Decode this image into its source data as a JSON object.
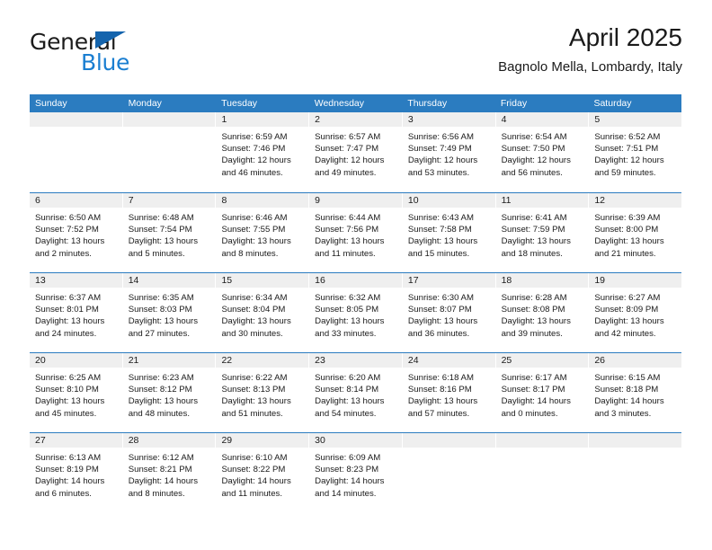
{
  "brand": {
    "name_dark": "General",
    "name_light": "Blue",
    "accent_blue": "#1a7ed1",
    "triangle_blue": "#1464ad"
  },
  "header": {
    "title": "April 2025",
    "subtitle": "Bagnolo Mella, Lombardy, Italy"
  },
  "theme": {
    "header_bg": "#2b7cc0",
    "day_band_bg": "#efefef",
    "separator": "#2b7cc0"
  },
  "weekdays": [
    "Sunday",
    "Monday",
    "Tuesday",
    "Wednesday",
    "Thursday",
    "Friday",
    "Saturday"
  ],
  "weeks": [
    {
      "days": [
        {
          "number": "",
          "sunrise": "",
          "sunset": "",
          "daylight": ""
        },
        {
          "number": "",
          "sunrise": "",
          "sunset": "",
          "daylight": ""
        },
        {
          "number": "1",
          "sunrise": "Sunrise: 6:59 AM",
          "sunset": "Sunset: 7:46 PM",
          "daylight": "Daylight: 12 hours and 46 minutes."
        },
        {
          "number": "2",
          "sunrise": "Sunrise: 6:57 AM",
          "sunset": "Sunset: 7:47 PM",
          "daylight": "Daylight: 12 hours and 49 minutes."
        },
        {
          "number": "3",
          "sunrise": "Sunrise: 6:56 AM",
          "sunset": "Sunset: 7:49 PM",
          "daylight": "Daylight: 12 hours and 53 minutes."
        },
        {
          "number": "4",
          "sunrise": "Sunrise: 6:54 AM",
          "sunset": "Sunset: 7:50 PM",
          "daylight": "Daylight: 12 hours and 56 minutes."
        },
        {
          "number": "5",
          "sunrise": "Sunrise: 6:52 AM",
          "sunset": "Sunset: 7:51 PM",
          "daylight": "Daylight: 12 hours and 59 minutes."
        }
      ]
    },
    {
      "days": [
        {
          "number": "6",
          "sunrise": "Sunrise: 6:50 AM",
          "sunset": "Sunset: 7:52 PM",
          "daylight": "Daylight: 13 hours and 2 minutes."
        },
        {
          "number": "7",
          "sunrise": "Sunrise: 6:48 AM",
          "sunset": "Sunset: 7:54 PM",
          "daylight": "Daylight: 13 hours and 5 minutes."
        },
        {
          "number": "8",
          "sunrise": "Sunrise: 6:46 AM",
          "sunset": "Sunset: 7:55 PM",
          "daylight": "Daylight: 13 hours and 8 minutes."
        },
        {
          "number": "9",
          "sunrise": "Sunrise: 6:44 AM",
          "sunset": "Sunset: 7:56 PM",
          "daylight": "Daylight: 13 hours and 11 minutes."
        },
        {
          "number": "10",
          "sunrise": "Sunrise: 6:43 AM",
          "sunset": "Sunset: 7:58 PM",
          "daylight": "Daylight: 13 hours and 15 minutes."
        },
        {
          "number": "11",
          "sunrise": "Sunrise: 6:41 AM",
          "sunset": "Sunset: 7:59 PM",
          "daylight": "Daylight: 13 hours and 18 minutes."
        },
        {
          "number": "12",
          "sunrise": "Sunrise: 6:39 AM",
          "sunset": "Sunset: 8:00 PM",
          "daylight": "Daylight: 13 hours and 21 minutes."
        }
      ]
    },
    {
      "days": [
        {
          "number": "13",
          "sunrise": "Sunrise: 6:37 AM",
          "sunset": "Sunset: 8:01 PM",
          "daylight": "Daylight: 13 hours and 24 minutes."
        },
        {
          "number": "14",
          "sunrise": "Sunrise: 6:35 AM",
          "sunset": "Sunset: 8:03 PM",
          "daylight": "Daylight: 13 hours and 27 minutes."
        },
        {
          "number": "15",
          "sunrise": "Sunrise: 6:34 AM",
          "sunset": "Sunset: 8:04 PM",
          "daylight": "Daylight: 13 hours and 30 minutes."
        },
        {
          "number": "16",
          "sunrise": "Sunrise: 6:32 AM",
          "sunset": "Sunset: 8:05 PM",
          "daylight": "Daylight: 13 hours and 33 minutes."
        },
        {
          "number": "17",
          "sunrise": "Sunrise: 6:30 AM",
          "sunset": "Sunset: 8:07 PM",
          "daylight": "Daylight: 13 hours and 36 minutes."
        },
        {
          "number": "18",
          "sunrise": "Sunrise: 6:28 AM",
          "sunset": "Sunset: 8:08 PM",
          "daylight": "Daylight: 13 hours and 39 minutes."
        },
        {
          "number": "19",
          "sunrise": "Sunrise: 6:27 AM",
          "sunset": "Sunset: 8:09 PM",
          "daylight": "Daylight: 13 hours and 42 minutes."
        }
      ]
    },
    {
      "days": [
        {
          "number": "20",
          "sunrise": "Sunrise: 6:25 AM",
          "sunset": "Sunset: 8:10 PM",
          "daylight": "Daylight: 13 hours and 45 minutes."
        },
        {
          "number": "21",
          "sunrise": "Sunrise: 6:23 AM",
          "sunset": "Sunset: 8:12 PM",
          "daylight": "Daylight: 13 hours and 48 minutes."
        },
        {
          "number": "22",
          "sunrise": "Sunrise: 6:22 AM",
          "sunset": "Sunset: 8:13 PM",
          "daylight": "Daylight: 13 hours and 51 minutes."
        },
        {
          "number": "23",
          "sunrise": "Sunrise: 6:20 AM",
          "sunset": "Sunset: 8:14 PM",
          "daylight": "Daylight: 13 hours and 54 minutes."
        },
        {
          "number": "24",
          "sunrise": "Sunrise: 6:18 AM",
          "sunset": "Sunset: 8:16 PM",
          "daylight": "Daylight: 13 hours and 57 minutes."
        },
        {
          "number": "25",
          "sunrise": "Sunrise: 6:17 AM",
          "sunset": "Sunset: 8:17 PM",
          "daylight": "Daylight: 14 hours and 0 minutes."
        },
        {
          "number": "26",
          "sunrise": "Sunrise: 6:15 AM",
          "sunset": "Sunset: 8:18 PM",
          "daylight": "Daylight: 14 hours and 3 minutes."
        }
      ]
    },
    {
      "days": [
        {
          "number": "27",
          "sunrise": "Sunrise: 6:13 AM",
          "sunset": "Sunset: 8:19 PM",
          "daylight": "Daylight: 14 hours and 6 minutes."
        },
        {
          "number": "28",
          "sunrise": "Sunrise: 6:12 AM",
          "sunset": "Sunset: 8:21 PM",
          "daylight": "Daylight: 14 hours and 8 minutes."
        },
        {
          "number": "29",
          "sunrise": "Sunrise: 6:10 AM",
          "sunset": "Sunset: 8:22 PM",
          "daylight": "Daylight: 14 hours and 11 minutes."
        },
        {
          "number": "30",
          "sunrise": "Sunrise: 6:09 AM",
          "sunset": "Sunset: 8:23 PM",
          "daylight": "Daylight: 14 hours and 14 minutes."
        },
        {
          "number": "",
          "sunrise": "",
          "sunset": "",
          "daylight": ""
        },
        {
          "number": "",
          "sunrise": "",
          "sunset": "",
          "daylight": ""
        },
        {
          "number": "",
          "sunrise": "",
          "sunset": "",
          "daylight": ""
        }
      ]
    }
  ]
}
